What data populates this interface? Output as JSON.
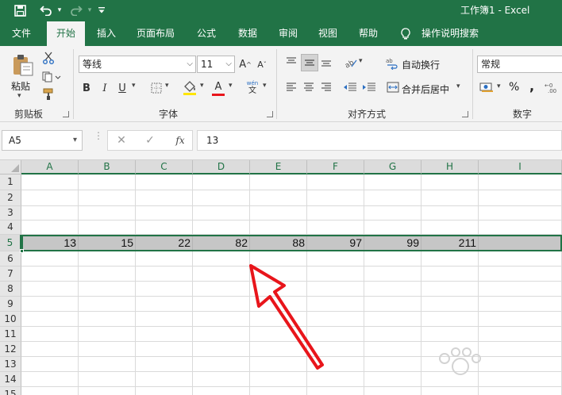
{
  "titlebar": {
    "title": "工作簿1  -  Excel",
    "save_icon": "save-icon",
    "undo_icon": "undo-icon",
    "redo_icon": "redo-icon",
    "customize_icon": "customize-quick-access-icon"
  },
  "tabs": [
    "文件",
    "开始",
    "插入",
    "页面布局",
    "公式",
    "数据",
    "审阅",
    "视图",
    "帮助"
  ],
  "active_tab": "开始",
  "tell_me": "操作说明搜索",
  "clipboard": {
    "paste_label": "粘贴",
    "group_label": "剪贴板"
  },
  "font": {
    "font_name": "等线",
    "font_size": "11",
    "bold": "B",
    "italic": "I",
    "underline": "U",
    "font_color_letter": "A",
    "phonetic": "文",
    "grow": "A",
    "shrink": "A",
    "group_label": "字体"
  },
  "alignment": {
    "wrap_text": "自动换行",
    "merge_center": "合并后居中",
    "group_label": "对齐方式"
  },
  "number": {
    "format": "常规",
    "percent": "%",
    "comma": ",",
    "group_label": "数字"
  },
  "formula_bar": {
    "name_box": "A5",
    "cancel": "✕",
    "enter": "✓",
    "fx": "fx",
    "value": "13"
  },
  "grid": {
    "columns": [
      "A",
      "B",
      "C",
      "D",
      "E",
      "F",
      "G",
      "H",
      "I"
    ],
    "rows": [
      "1",
      "2",
      "3",
      "4",
      "5",
      "6",
      "7",
      "8",
      "9",
      "10",
      "11",
      "12",
      "13",
      "14",
      "15"
    ],
    "selected_row": "5",
    "row5_values": [
      "13",
      "15",
      "22",
      "82",
      "88",
      "97",
      "99",
      "211",
      ""
    ]
  },
  "colors": {
    "accent": "#217346",
    "annotation_arrow": "#e8151b",
    "selection_fill": "#c6c6c6"
  }
}
